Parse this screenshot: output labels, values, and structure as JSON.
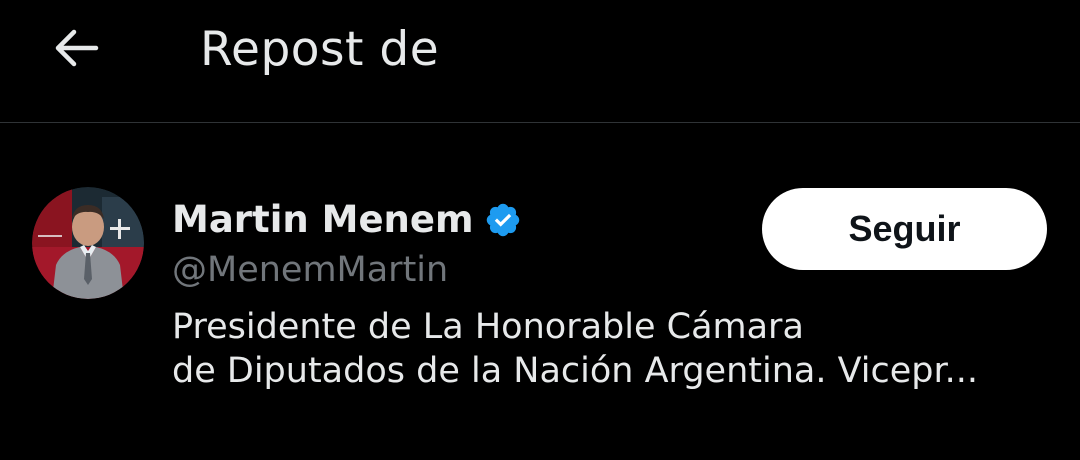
{
  "header": {
    "back_icon": "arrow-left-icon",
    "title": "Repost de"
  },
  "user": {
    "avatar_icon": "user-avatar",
    "display_name": "Martin Menem",
    "verified_icon": "verified-badge-icon",
    "verified_color": "#1d9bf0",
    "handle": "@MenemMartin",
    "bio_lines": [
      "Presidente de La Honorable Cámara",
      "de Diputados de la Nación Argentina. Vicepr..."
    ],
    "follow_label": "Seguir"
  }
}
